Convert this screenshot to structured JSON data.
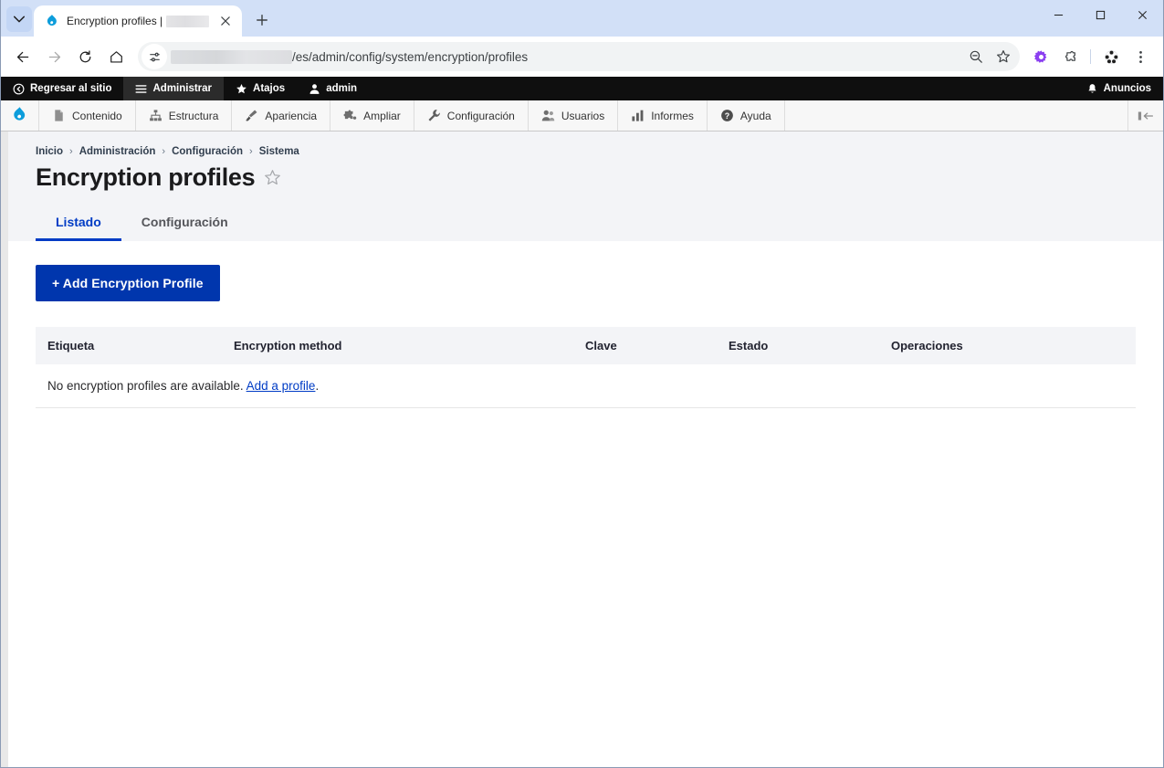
{
  "browser": {
    "tab": {
      "title": "Encryption profiles |",
      "redacted_suffix": true,
      "favicon": "drupal-droplet-icon"
    },
    "new_tab_tooltip": "Nueva pestaña",
    "window_controls": {
      "minimize": "minimize-icon",
      "maximize": "maximize-icon",
      "close": "close-icon"
    },
    "nav": {
      "back": "back-arrow-icon",
      "forward": "forward-arrow-icon",
      "reload": "reload-icon",
      "home": "home-icon"
    },
    "omnibox": {
      "site_settings_icon": "page-settings-icon",
      "url_redacted": true,
      "url_path": "/es/admin/config/system/encryption/profiles",
      "zoom_icon": "zoom-out-icon",
      "bookmark_icon": "bookmark-star-icon"
    },
    "extensions": {
      "gear_ext": "purple-gear-icon",
      "puzzle": "extensions-puzzle-icon",
      "profile": "profile-avatar-icon",
      "menu": "three-dot-menu-icon"
    }
  },
  "admin_toolbar": {
    "items": [
      {
        "label": "Regresar al sitio",
        "icon": "back-circle-icon",
        "active": false
      },
      {
        "label": "Administrar",
        "icon": "hamburger-icon",
        "active": true
      },
      {
        "label": "Atajos",
        "icon": "star-icon",
        "active": false
      },
      {
        "label": "admin",
        "icon": "user-icon",
        "active": false
      }
    ],
    "announcements": {
      "label": "Anuncios",
      "icon": "bell-icon"
    }
  },
  "admin_menu": {
    "logo": "drupal-logo-icon",
    "items": [
      {
        "label": "Contenido",
        "icon": "file-icon"
      },
      {
        "label": "Estructura",
        "icon": "sitemap-icon"
      },
      {
        "label": "Apariencia",
        "icon": "paintbrush-icon"
      },
      {
        "label": "Ampliar",
        "icon": "puzzle-piece-icon"
      },
      {
        "label": "Configuración",
        "icon": "wrench-icon"
      },
      {
        "label": "Usuarios",
        "icon": "users-icon"
      },
      {
        "label": "Informes",
        "icon": "bar-chart-icon"
      },
      {
        "label": "Ayuda",
        "icon": "question-circle-icon"
      }
    ],
    "orientation_toggle": "toolbar-orientation-icon"
  },
  "page": {
    "breadcrumb": [
      "Inicio",
      "Administración",
      "Configuración",
      "Sistema"
    ],
    "breadcrumb_separator": "›",
    "title": "Encryption profiles",
    "favorite_icon": "star-outline-icon",
    "tabs": [
      {
        "label": "Listado",
        "active": true
      },
      {
        "label": "Configuración",
        "active": false
      }
    ],
    "add_button": "+ Add Encryption Profile",
    "table": {
      "headers": [
        "Etiqueta",
        "Encryption method",
        "Clave",
        "Estado",
        "Operaciones"
      ],
      "rows": [],
      "empty_message_prefix": "No encryption profiles are available. ",
      "empty_message_link": "Add a profile",
      "empty_message_suffix": "."
    }
  },
  "colors": {
    "primary_blue": "#0036ad",
    "link_blue": "#003cc5",
    "header_bg": "#f3f4f7",
    "toolbar_dark": "#0f0f0f",
    "drupal_cyan": "#0ea5e9"
  }
}
